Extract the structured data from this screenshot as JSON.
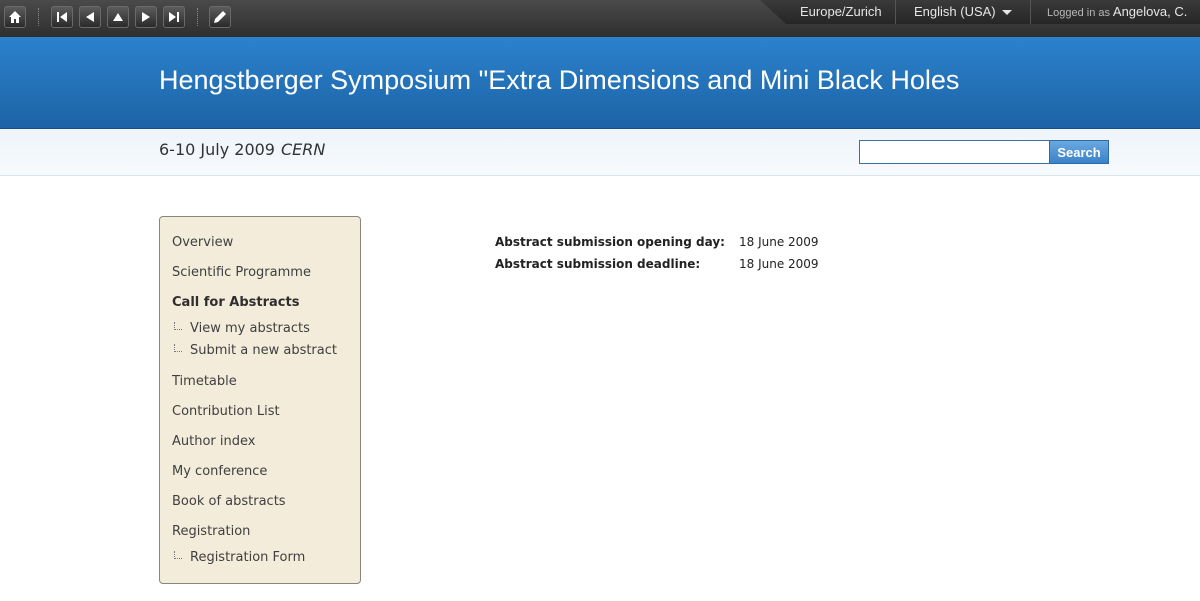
{
  "toolbar": {
    "buttons": [
      "home-icon",
      "first-icon",
      "previous-icon",
      "up-icon",
      "next-icon",
      "last-icon",
      "pencil-icon"
    ],
    "timezone": "Europe/Zurich",
    "language": "English (USA)",
    "logged_in_label": "Logged in as",
    "user": "Angelova, C."
  },
  "banner": {
    "title": "Hengstberger Symposium \"Extra Dimensions and Mini Black Holes",
    "color": "#2475bd"
  },
  "subheader": {
    "date": "6-10 July 2009",
    "place": "CERN",
    "search_placeholder": "",
    "search_button": "Search"
  },
  "sidebar": {
    "items": [
      {
        "label": "Overview"
      },
      {
        "label": "Scientific Programme"
      },
      {
        "label": "Call for Abstracts"
      },
      {
        "label": "View my abstracts"
      },
      {
        "label": "Submit a new abstract"
      },
      {
        "label": "Timetable"
      },
      {
        "label": "Contribution List"
      },
      {
        "label": "Author index"
      },
      {
        "label": "My conference"
      },
      {
        "label": "Book of abstracts"
      },
      {
        "label": "Registration"
      },
      {
        "label": "Registration Form"
      }
    ],
    "background": "#f3ecdb"
  },
  "main": {
    "rows": [
      {
        "label": "Abstract submission opening day:",
        "value": "18 June 2009"
      },
      {
        "label": "Abstract submission deadline:",
        "value": "18 June 2009"
      }
    ]
  }
}
